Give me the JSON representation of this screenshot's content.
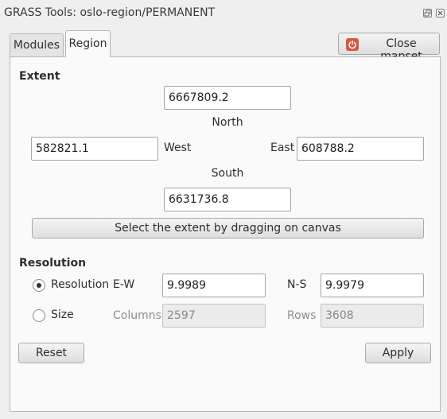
{
  "window": {
    "title": "GRASS Tools: oslo-region/PERMANENT"
  },
  "tabs": [
    {
      "label": "Modules",
      "active": false
    },
    {
      "label": "Region",
      "active": true
    }
  ],
  "close_mapset": {
    "label": "Close mapset",
    "icon": "power-icon",
    "icon_color": "#d8593e"
  },
  "extent": {
    "heading": "Extent",
    "north": {
      "value": "6667809.2",
      "label": "North"
    },
    "west": {
      "value": "582821.1",
      "label": "West"
    },
    "east": {
      "value": "608788.2",
      "label": "East"
    },
    "south": {
      "value": "6631736.8",
      "label": "South"
    },
    "drag_button": "Select the extent by dragging on canvas"
  },
  "resolution": {
    "heading": "Resolution",
    "resolution_option": {
      "label": "Resolution",
      "selected": true
    },
    "size_option": {
      "label": "Size",
      "selected": false
    },
    "ew_label": "E-W",
    "ew_value": "9.9989",
    "ns_label": "N-S",
    "ns_value": "9.9979",
    "columns_label": "Columns",
    "columns_value": "2597",
    "rows_label": "Rows",
    "rows_value": "3608"
  },
  "buttons": {
    "reset": "Reset",
    "apply": "Apply"
  }
}
